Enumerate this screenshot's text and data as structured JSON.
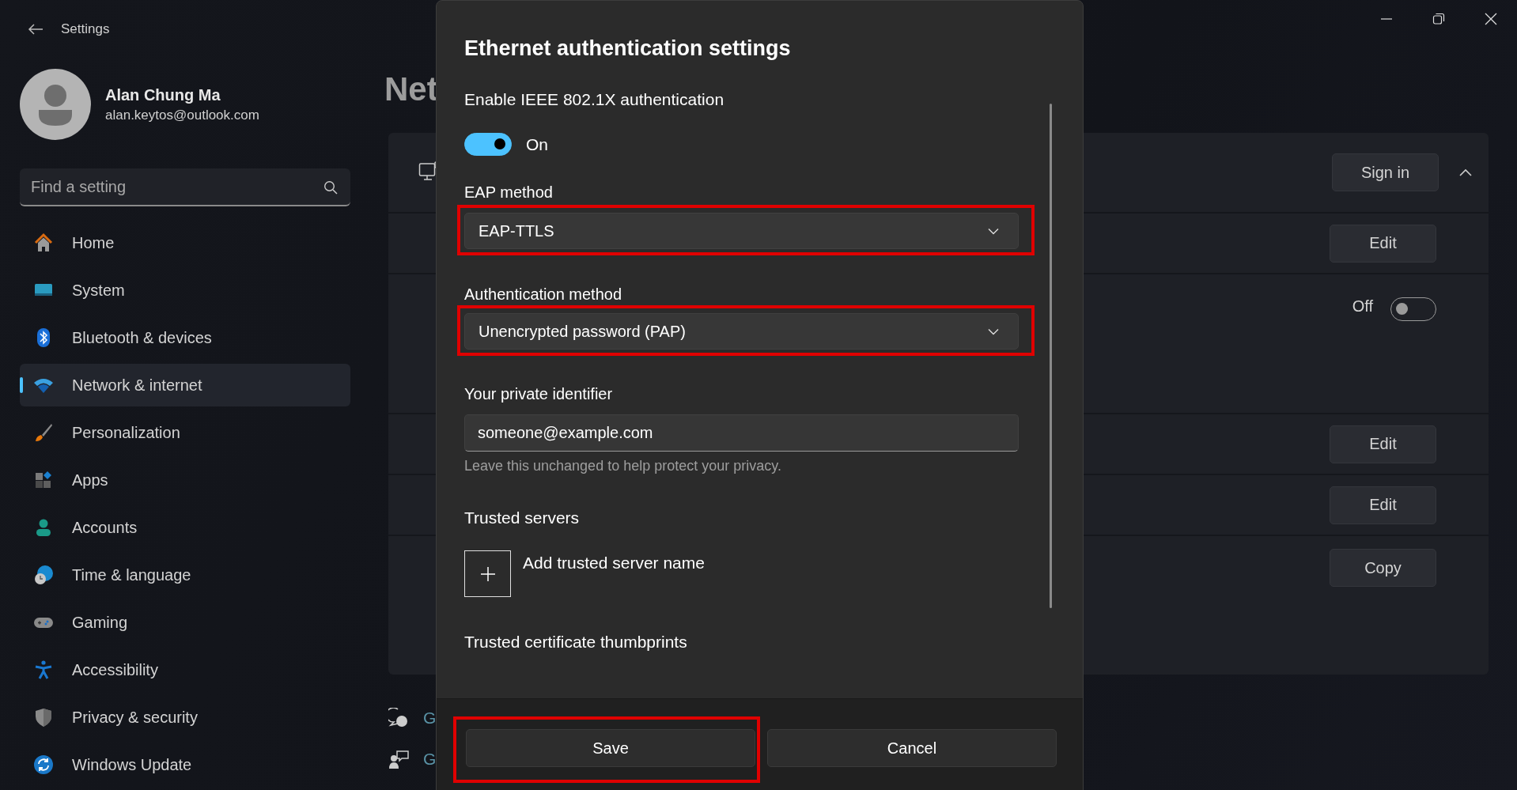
{
  "window": {
    "title": "Settings"
  },
  "account": {
    "name": "Alan Chung Ma",
    "email": "alan.keytos@outlook.com"
  },
  "search": {
    "placeholder": "Find a setting"
  },
  "nav": [
    {
      "label": "Home",
      "selected": false
    },
    {
      "label": "System",
      "selected": false
    },
    {
      "label": "Bluetooth & devices",
      "selected": false
    },
    {
      "label": "Network & internet",
      "selected": true
    },
    {
      "label": "Personalization",
      "selected": false
    },
    {
      "label": "Apps",
      "selected": false
    },
    {
      "label": "Accounts",
      "selected": false
    },
    {
      "label": "Time & language",
      "selected": false
    },
    {
      "label": "Gaming",
      "selected": false
    },
    {
      "label": "Accessibility",
      "selected": false
    },
    {
      "label": "Privacy & security",
      "selected": false
    },
    {
      "label": "Windows Update",
      "selected": false
    }
  ],
  "page": {
    "heading": "Net",
    "expanded": true,
    "rows": [
      {
        "kind": "button",
        "label": "Sign in"
      },
      {
        "kind": "button",
        "label": "Edit"
      },
      {
        "kind": "toggle",
        "label": "Off",
        "on": false
      },
      {
        "kind": "button",
        "label": "Edit"
      },
      {
        "kind": "button",
        "label": "Edit"
      },
      {
        "kind": "button",
        "label": "Copy"
      }
    ],
    "links": [
      {
        "text": "G"
      },
      {
        "text": "G"
      }
    ]
  },
  "dialog": {
    "title": "Ethernet authentication settings",
    "enable_label": "Enable IEEE 802.1X authentication",
    "toggle": {
      "on": true,
      "label": "On"
    },
    "fields": [
      {
        "kind": "dropdown",
        "label": "EAP method",
        "value": "EAP-TTLS",
        "highlighted": true
      },
      {
        "kind": "dropdown",
        "label": "Authentication method",
        "value": "Unencrypted password (PAP)",
        "highlighted": true
      },
      {
        "kind": "text",
        "label": "Your private identifier",
        "value": "someone@example.com",
        "hint": "Leave this unchanged to help protect your privacy."
      }
    ],
    "trusted_servers": {
      "heading": "Trusted servers",
      "add_label": "Add trusted server name"
    },
    "thumbprints_heading": "Trusted certificate thumbprints",
    "buttons": [
      {
        "label": "Save",
        "highlighted": true
      },
      {
        "label": "Cancel",
        "highlighted": false
      }
    ]
  }
}
